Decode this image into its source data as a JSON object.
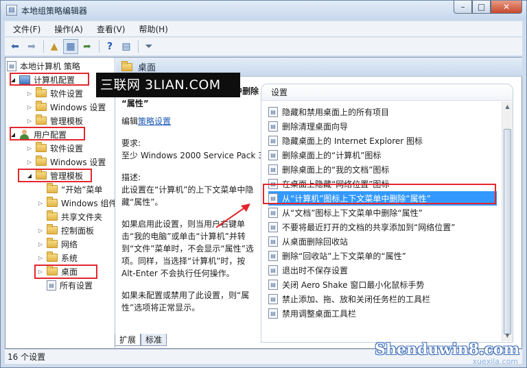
{
  "window": {
    "title": "本地组策略编辑器",
    "minimize": "–",
    "maximize": "□",
    "close": "✕"
  },
  "menu": {
    "file": "文件(F)",
    "action": "操作(A)",
    "view": "查看(V)",
    "help": "帮助(H)"
  },
  "toolbar_icons": [
    "back-icon",
    "forward-icon",
    "up-icon",
    "show-hide-tree-icon",
    "export-icon",
    "help-icon",
    "properties-icon",
    "filter-icon"
  ],
  "tree": {
    "root": "本地计算机 策略",
    "computer_config": "计算机配置",
    "cc_software": "软件设置",
    "cc_windows": "Windows 设置",
    "cc_admin": "管理模板",
    "user_config": "用户配置",
    "uc_software": "软件设置",
    "uc_windows": "Windows 设置",
    "uc_admin": "管理模板",
    "start_menu": "“开始”菜单",
    "windows_components": "Windows 组件",
    "shared_folders": "共享文件夹",
    "control_panel": "控制面板",
    "network": "网络",
    "system": "系统",
    "desktop": "桌面",
    "all_settings": "所有设置"
  },
  "header": {
    "title": "桌面"
  },
  "watermark_top": "三联网 3LIAN.COM",
  "description": {
    "title_tail": "中删除",
    "title_line2": "“属性”",
    "edit_prefix": "编辑",
    "edit_link": "策略设置",
    "requirement_label": "要求:",
    "requirement_value": "至少 Windows 2000 Service Pack 3",
    "description_label": "描述:",
    "description_text": "此设置在“计算机”的上下文菜单中隐藏“属性”。",
    "enabled_text": "如果启用此设置，则当用户右键单击“我的电脑”或单击“计算机”并转到“文件”菜单时，不会显示“属性”选项。同样，当选择“计算机”时，按 Alt-Enter 不会执行任何操作。",
    "disabled_text": "如果未配置或禁用了此设置，则“属性”选项将正常显示。"
  },
  "list": {
    "header": "设置",
    "items": [
      "隐藏和禁用桌面上的所有项目",
      "删除清理桌面向导",
      "隐藏桌面上的 Internet Explorer 图标",
      "删除桌面上的“计算机”图标",
      "删除桌面上的“我的文档”图标",
      "在桌面上隐藏“网络位置”图标",
      "从“计算机”图标上下文菜单中删除“属性”",
      "从“文档”图标上下文菜单中删除“属性”",
      "不要将最近打开的文档的共享添加到“网络位置”",
      "从桌面删除回收站",
      "删除“回收站”上下文菜单的“属性”",
      "退出时不保存设置",
      "关闭 Aero Shake 窗口最小化鼠标手势",
      "禁止添加、拖、放和关闭任务栏的工具栏",
      "禁用调整桌面工具栏"
    ],
    "selected_index": 6
  },
  "tabs": {
    "extended": "扩展",
    "standard": "标准"
  },
  "status": {
    "text": "16 个设置"
  },
  "watermark_bottom": {
    "main": "Shenduwin8.com",
    "sub": "xuexila.com"
  },
  "colors": {
    "highlight_red": "#e3262c",
    "selected_blue": "#3399ff",
    "link": "#1a57b4"
  }
}
